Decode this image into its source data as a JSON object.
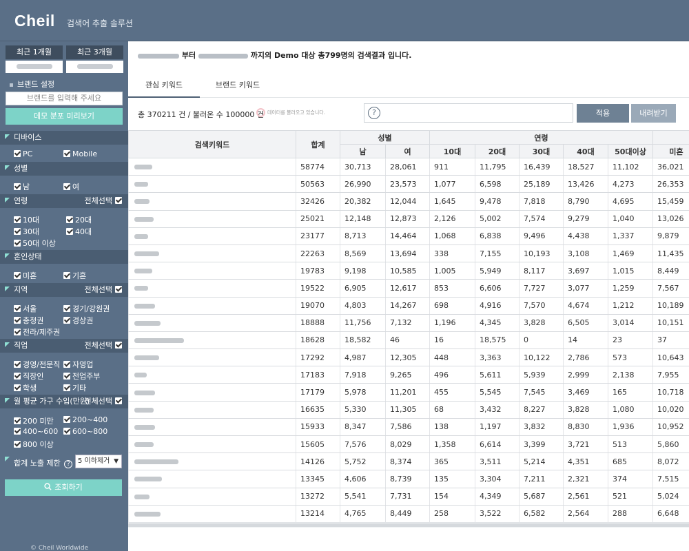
{
  "header": {
    "logo": "Cheil",
    "subtitle": "검색어 추출 솔루션"
  },
  "sidebar": {
    "period_1m": "최근 1개월",
    "period_3m": "최근 3개월",
    "brand_label": "브랜드 설정",
    "brand_placeholder": "브랜드를 입력해 주세요",
    "demo_button": "데모 분포 미리보기",
    "sections": {
      "device": {
        "title": "디바이스",
        "options": [
          "PC",
          "Mobile"
        ]
      },
      "gender": {
        "title": "성별",
        "options": [
          "남",
          "여"
        ]
      },
      "age": {
        "title": "연령",
        "select_all": "전체선택",
        "options": [
          "10대",
          "20대",
          "30대",
          "40대",
          "50대 이상"
        ]
      },
      "marital": {
        "title": "혼인상태",
        "options": [
          "미혼",
          "기혼"
        ]
      },
      "region": {
        "title": "지역",
        "select_all": "전체선택",
        "options": [
          "서울",
          "경기/강원권",
          "충청권",
          "경상권",
          "전라/제주권"
        ]
      },
      "job": {
        "title": "직업",
        "select_all": "전체선택",
        "options": [
          "경영/전문직",
          "자영업",
          "직장인",
          "전업주부",
          "학생",
          "기타"
        ]
      },
      "income": {
        "title": "월 평균 가구 수입(만원)",
        "select_all": "전체선택",
        "options": [
          "200 미만",
          "200~400",
          "400~600",
          "600~800",
          "800 이상"
        ]
      }
    },
    "limit_label": "합계 노출 제한",
    "limit_value": "5 이하제거",
    "search_button": "조회하기",
    "copyright": "© Cheil Worldwide"
  },
  "main": {
    "result_parts": [
      "부터",
      "까지의 Demo 대상 총799명의 검색결과 입니다."
    ],
    "tabs": [
      "관심 키워드",
      "브랜드 키워드"
    ],
    "total_text": "총 370211 건 / 불러온 수 100000 건",
    "loading_note": "데이터를 불러오고 있습니다.",
    "apply_button": "적용",
    "download_button": "내려받기",
    "columns": {
      "keyword": "검색키워드",
      "total": "합계",
      "gender": "성별",
      "male": "남",
      "female": "여",
      "age": "연령",
      "a10": "10대",
      "a20": "20대",
      "a30": "30대",
      "a40": "40대",
      "a50": "50대이상",
      "single": "미혼"
    },
    "rows": [
      [
        "58774",
        "30,713",
        "28,061",
        "911",
        "11,795",
        "16,439",
        "18,527",
        "11,102",
        "36,021"
      ],
      [
        "50563",
        "26,990",
        "23,573",
        "1,077",
        "6,598",
        "25,189",
        "13,426",
        "4,273",
        "26,353"
      ],
      [
        "32426",
        "20,382",
        "12,044",
        "1,645",
        "9,478",
        "7,818",
        "8,790",
        "4,695",
        "15,459"
      ],
      [
        "25021",
        "12,148",
        "12,873",
        "2,126",
        "5,002",
        "7,574",
        "9,279",
        "1,040",
        "13,026"
      ],
      [
        "23177",
        "8,713",
        "14,464",
        "1,068",
        "6,838",
        "9,496",
        "4,438",
        "1,337",
        "9,879"
      ],
      [
        "22263",
        "8,569",
        "13,694",
        "338",
        "7,155",
        "10,193",
        "3,108",
        "1,469",
        "11,435"
      ],
      [
        "19783",
        "9,198",
        "10,585",
        "1,005",
        "5,949",
        "8,117",
        "3,697",
        "1,015",
        "8,449"
      ],
      [
        "19522",
        "6,905",
        "12,617",
        "853",
        "6,606",
        "7,727",
        "3,077",
        "1,259",
        "7,567"
      ],
      [
        "19070",
        "4,803",
        "14,267",
        "698",
        "4,916",
        "7,570",
        "4,674",
        "1,212",
        "10,189"
      ],
      [
        "18888",
        "11,756",
        "7,132",
        "1,196",
        "4,345",
        "3,828",
        "6,505",
        "3,014",
        "10,151"
      ],
      [
        "18628",
        "18,582",
        "46",
        "16",
        "18,575",
        "0",
        "14",
        "23",
        "37"
      ],
      [
        "17292",
        "4,987",
        "12,305",
        "448",
        "3,363",
        "10,122",
        "2,786",
        "573",
        "10,643"
      ],
      [
        "17183",
        "7,918",
        "9,265",
        "496",
        "5,611",
        "5,939",
        "2,999",
        "2,138",
        "7,955"
      ],
      [
        "17179",
        "5,978",
        "11,201",
        "455",
        "5,545",
        "7,545",
        "3,469",
        "165",
        "10,718"
      ],
      [
        "16635",
        "5,330",
        "11,305",
        "68",
        "3,432",
        "8,227",
        "3,828",
        "1,080",
        "10,020"
      ],
      [
        "15933",
        "8,347",
        "7,586",
        "138",
        "1,197",
        "3,832",
        "8,830",
        "1,936",
        "10,952"
      ],
      [
        "15605",
        "7,576",
        "8,029",
        "1,358",
        "6,614",
        "3,399",
        "3,721",
        "513",
        "5,860"
      ],
      [
        "14126",
        "5,752",
        "8,374",
        "365",
        "3,511",
        "5,214",
        "4,351",
        "685",
        "8,072"
      ],
      [
        "13345",
        "4,606",
        "8,739",
        "135",
        "3,304",
        "7,211",
        "2,321",
        "374",
        "7,515"
      ],
      [
        "13272",
        "5,541",
        "7,731",
        "154",
        "4,349",
        "5,687",
        "2,561",
        "521",
        "5,024"
      ],
      [
        "13214",
        "4,765",
        "8,449",
        "258",
        "3,522",
        "6,582",
        "2,564",
        "288",
        "6,648"
      ]
    ]
  },
  "icons": {
    "search": "magnifier-icon",
    "help": "question-icon",
    "dropdown": "chevron-down-icon"
  },
  "colors": {
    "sidebar": "#5a6f87",
    "section_header": "#4a5d72",
    "accent": "#7dd3c8",
    "apply": "#6e8194",
    "download": "#9aa9b8"
  }
}
